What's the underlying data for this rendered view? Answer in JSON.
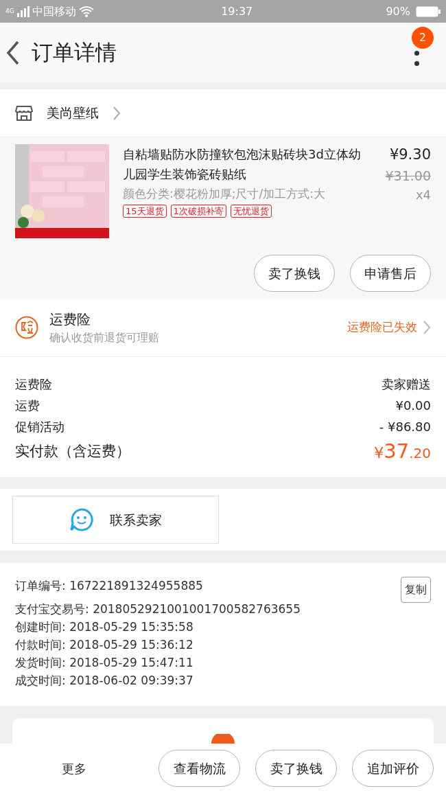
{
  "status_bar": {
    "network": "4G",
    "carrier": "中国移动",
    "time": "19:37",
    "battery": "90%"
  },
  "header": {
    "title": "订单详情",
    "badge": "2"
  },
  "shop": {
    "name": "美尚壁纸"
  },
  "product": {
    "title": "自粘墙贴防水防撞软包泡沫贴砖块3d立体幼儿园学生装饰瓷砖贴纸",
    "sku": "颜色分类:樱花粉加厚;尺寸/加工方式:大",
    "price": "¥9.30",
    "original_price": "¥31.00",
    "quantity": "x4",
    "tags": [
      "15天退货",
      "1次破损补寄",
      "无忧退货"
    ],
    "buttons": [
      "卖了换钱",
      "申请售后"
    ]
  },
  "insurance": {
    "title": "运费险",
    "subtitle": "确认收货前退货可理赔",
    "status": "运费险已失效"
  },
  "costs": [
    {
      "label": "运费险",
      "value": "卖家赠送"
    },
    {
      "label": "运费",
      "value": "¥0.00"
    },
    {
      "label": "促销活动",
      "value": "- ¥86.80"
    }
  ],
  "total": {
    "label": "实付款（含运费）",
    "currency": "¥",
    "amount": "37",
    "cents": ".20"
  },
  "contact_button": "联系卖家",
  "order_info": {
    "copy_button": "复制",
    "rows": [
      {
        "label": "订单编号:",
        "value": "167221891324955885"
      },
      {
        "label": "支付宝交易号:",
        "value": "2018052921001001700582763655"
      },
      {
        "label": "创建时间:",
        "value": "2018-05-29 15:35:58"
      },
      {
        "label": "付款时间:",
        "value": "2018-05-29 15:36:12"
      },
      {
        "label": "发货时间:",
        "value": "2018-05-29 15:47:11"
      },
      {
        "label": "成交时间:",
        "value": "2018-06-02 09:39:37"
      }
    ]
  },
  "bottom_bar": {
    "more": "更多",
    "buttons": [
      "查看物流",
      "卖了换钱",
      "追加评价"
    ]
  }
}
